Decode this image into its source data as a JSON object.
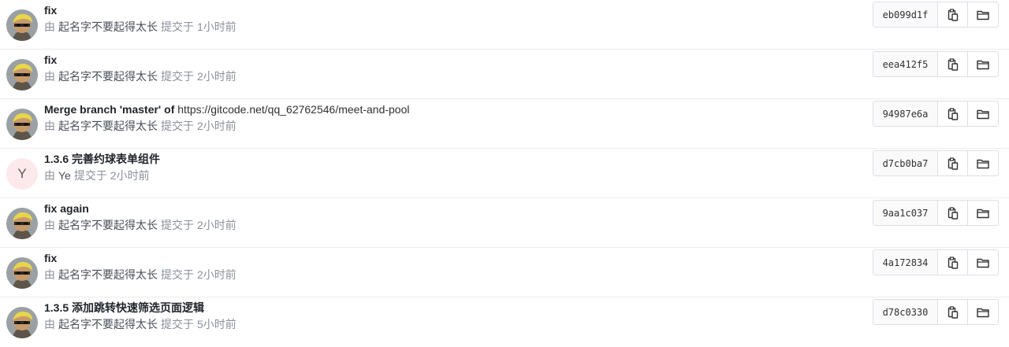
{
  "meta_labels": {
    "by": "由",
    "committed": "提交于"
  },
  "commits": [
    {
      "title": "fix",
      "title_link": "",
      "author": "起名字不要起得太长",
      "time": "1小时前",
      "sha": "eb099d1f",
      "avatar": "image"
    },
    {
      "title": "fix",
      "title_link": "",
      "author": "起名字不要起得太长",
      "time": "2小时前",
      "sha": "eea412f5",
      "avatar": "image"
    },
    {
      "title": "Merge branch 'master' of",
      "title_link": "https://gitcode.net/qq_62762546/meet-and-pool",
      "author": "起名字不要起得太长",
      "time": "2小时前",
      "sha": "94987e6a",
      "avatar": "image"
    },
    {
      "title": "1.3.6 完善约球表单组件",
      "title_link": "",
      "author": "Ye",
      "time": "2小时前",
      "sha": "d7cb0ba7",
      "avatar": "letter",
      "avatar_letter": "Y"
    },
    {
      "title": "fix again",
      "title_link": "",
      "author": "起名字不要起得太长",
      "time": "2小时前",
      "sha": "9aa1c037",
      "avatar": "image"
    },
    {
      "title": "fix",
      "title_link": "",
      "author": "起名字不要起得太长",
      "time": "2小时前",
      "sha": "4a172834",
      "avatar": "image"
    },
    {
      "title": "1.3.5 添加跳转快速筛选页面逻辑",
      "title_link": "",
      "author": "起名字不要起得太长",
      "time": "5小时前",
      "sha": "d78c0330",
      "avatar": "image"
    }
  ],
  "icons": {
    "copy": "copy-icon",
    "browse": "folder-icon"
  },
  "colors": {
    "border": "#dcdfe6",
    "muted_text": "#8a8f99",
    "letter_avatar_bg": "#fde9ec"
  }
}
